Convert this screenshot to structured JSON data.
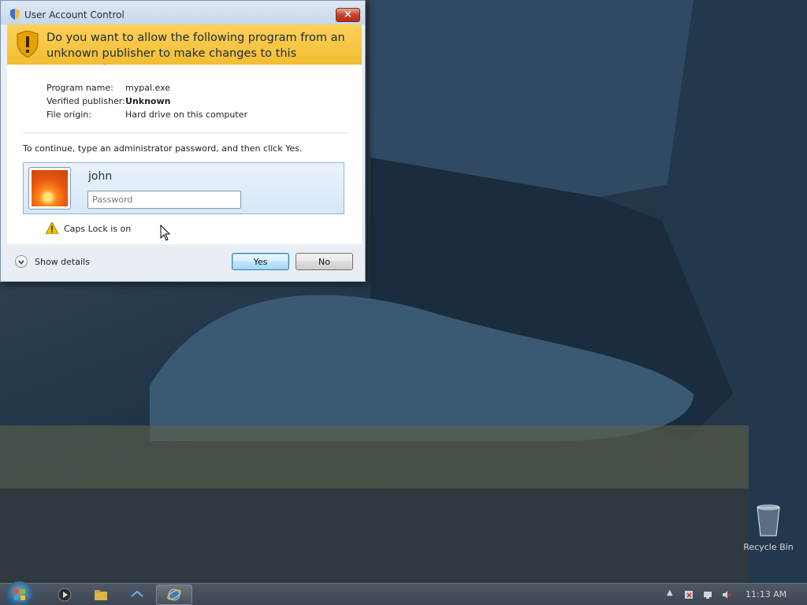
{
  "dialog": {
    "title": "User Account Control",
    "close_glyph": "×",
    "question": "Do you want to allow the following program from an unknown publisher to make changes to this computer?",
    "program_name_label": "Program name:",
    "program_name_value": "mypal.exe",
    "publisher_label": "Verified publisher:",
    "publisher_value": "Unknown",
    "origin_label": "File origin:",
    "origin_value": "Hard drive on this computer",
    "instruction": "To continue, type an administrator password, and then click Yes.",
    "username": "john",
    "password_placeholder": "Password",
    "password_value": "",
    "caps_lock_text": "Caps Lock is on",
    "show_details_label": "Show details",
    "yes_label": "Yes",
    "no_label": "No"
  },
  "desktop": {
    "recycle_bin_label": "Recycle Bin"
  },
  "taskbar": {
    "clock": "11:13 AM"
  },
  "colors": {
    "banner_yellow": "#f3bd33",
    "close_red": "#c8402a",
    "default_button_blue": "#3c7fb1"
  },
  "icons": [
    "shield-icon",
    "warning-icon",
    "chevron-down-icon",
    "recycle-bin-icon",
    "start-orb-icon",
    "browser-icon"
  ]
}
